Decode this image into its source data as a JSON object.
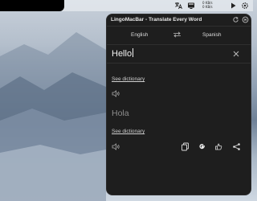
{
  "app": {
    "title": "LingoMacBar - Translate Every Word"
  },
  "menubar": {
    "net_up": "0 KB/s",
    "net_down": "0 KB/s"
  },
  "languages": {
    "source": "English",
    "target": "Spanish"
  },
  "input": {
    "value": "Hello"
  },
  "source_section": {
    "dictionary_link": "See dictionary"
  },
  "output": {
    "value": "Hola",
    "dictionary_link": "See dictionary"
  },
  "icons": {
    "menubar": [
      "translate-app-icon",
      "display-icon",
      "network-speed-icon",
      "play-icon",
      "settings-icon"
    ],
    "title": [
      "refresh-icon",
      "power-icon"
    ],
    "actions": [
      "copy-icon",
      "google-icon",
      "feedback-icon",
      "share-icon"
    ]
  }
}
